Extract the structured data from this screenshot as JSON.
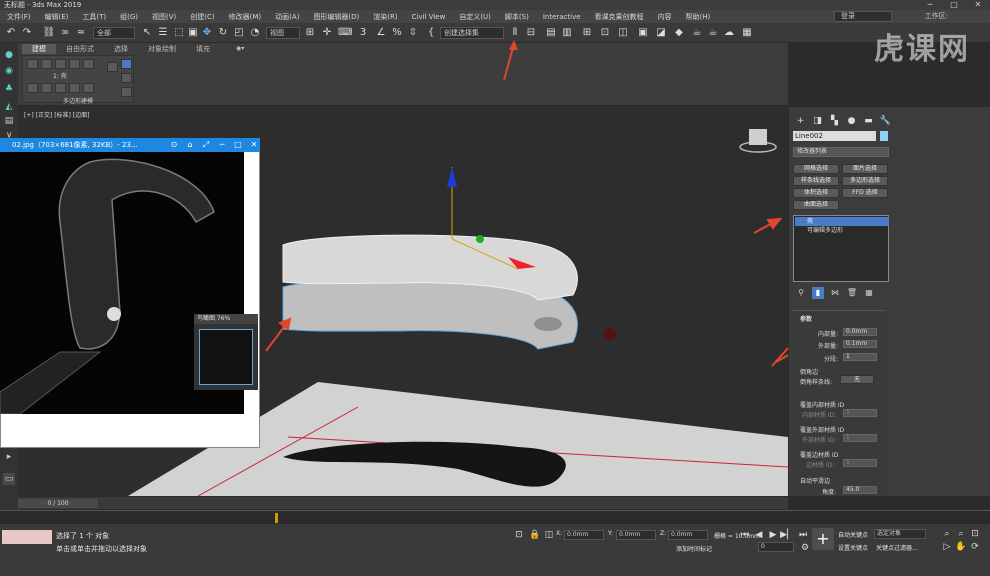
{
  "window": {
    "title": "无标题 - 3ds Max 2019"
  },
  "menu": [
    "文件(F)",
    "编辑(E)",
    "工具(T)",
    "组(G)",
    "视图(V)",
    "创建(C)",
    "修改器(M)",
    "动画(A)",
    "图形编辑器(D)",
    "渲染(R)",
    "Civil View",
    "自定义(U)",
    "脚本(S)",
    "Interactive",
    "看课克果创教程",
    "内容",
    "帮助(H)"
  ],
  "account": {
    "signin": "登录",
    "workspace": "工作区:"
  },
  "toolbar": {
    "filter": "全部",
    "refcoord": "视图",
    "selset": "创建选择集"
  },
  "ribbon": {
    "tabs": [
      "建模",
      "自由形式",
      "选择",
      "对象绘制",
      "填充"
    ],
    "subobj": "1: 壳",
    "caption": "多边形建模"
  },
  "viewport": {
    "label": "[+] [正交] [标准] [边面]"
  },
  "viewer": {
    "title": "02.jpg（703×681像素, 32KB）- 23...",
    "nav_title": "鸟瞰图 76%"
  },
  "command": {
    "obj_name": "Line002",
    "modifier_list": "修改器列表",
    "buttons": [
      "网格选择",
      "面片选择",
      "样条线选择",
      "多边形选择",
      "体积选择",
      "FFD 选择",
      "曲面选择"
    ],
    "stack": [
      "壳",
      "可编辑多边形"
    ],
    "params": {
      "title": "参数",
      "inner_label": "内部量:",
      "inner_value": "0.0mm",
      "outer_label": "外部量:",
      "outer_value": "0.1mm",
      "segments_label": "分段:",
      "segments_value": "1",
      "bevel_edges": "倒角边",
      "bevel_spline_label": "倒角样条线:",
      "bevel_spline_value": "无",
      "override_inner": "覆盖内部材质 ID",
      "inner_mat": "内部材质 ID:",
      "inner_mat_value": "1",
      "override_outer": "覆盖外部材质 ID",
      "outer_mat": "外部材质 ID:",
      "outer_mat_value": "1",
      "override_edge": "覆盖边材质 ID",
      "edge_mat": "边材质 ID:",
      "edge_mat_value": "1",
      "auto_smooth": "自动平滑边",
      "angle_label": "角度:",
      "angle_value": "45.0"
    }
  },
  "timeline": {
    "frame": "0 / 100"
  },
  "status": {
    "selected": "选择了 1 个 对象",
    "hint": "单击或单击并拖动以选择对象",
    "x": "0.0mm",
    "y": "0.0mm",
    "z": "0.0mm",
    "grid": "栅格 = 10.0mm",
    "addtime": "添加时间标记",
    "autokey": "自动关键点",
    "selobj": "选定对象",
    "setkey": "设置关键点",
    "keyfilters": "关键点过滤器...",
    "frame_field": "0"
  },
  "watermark": "虎课网"
}
